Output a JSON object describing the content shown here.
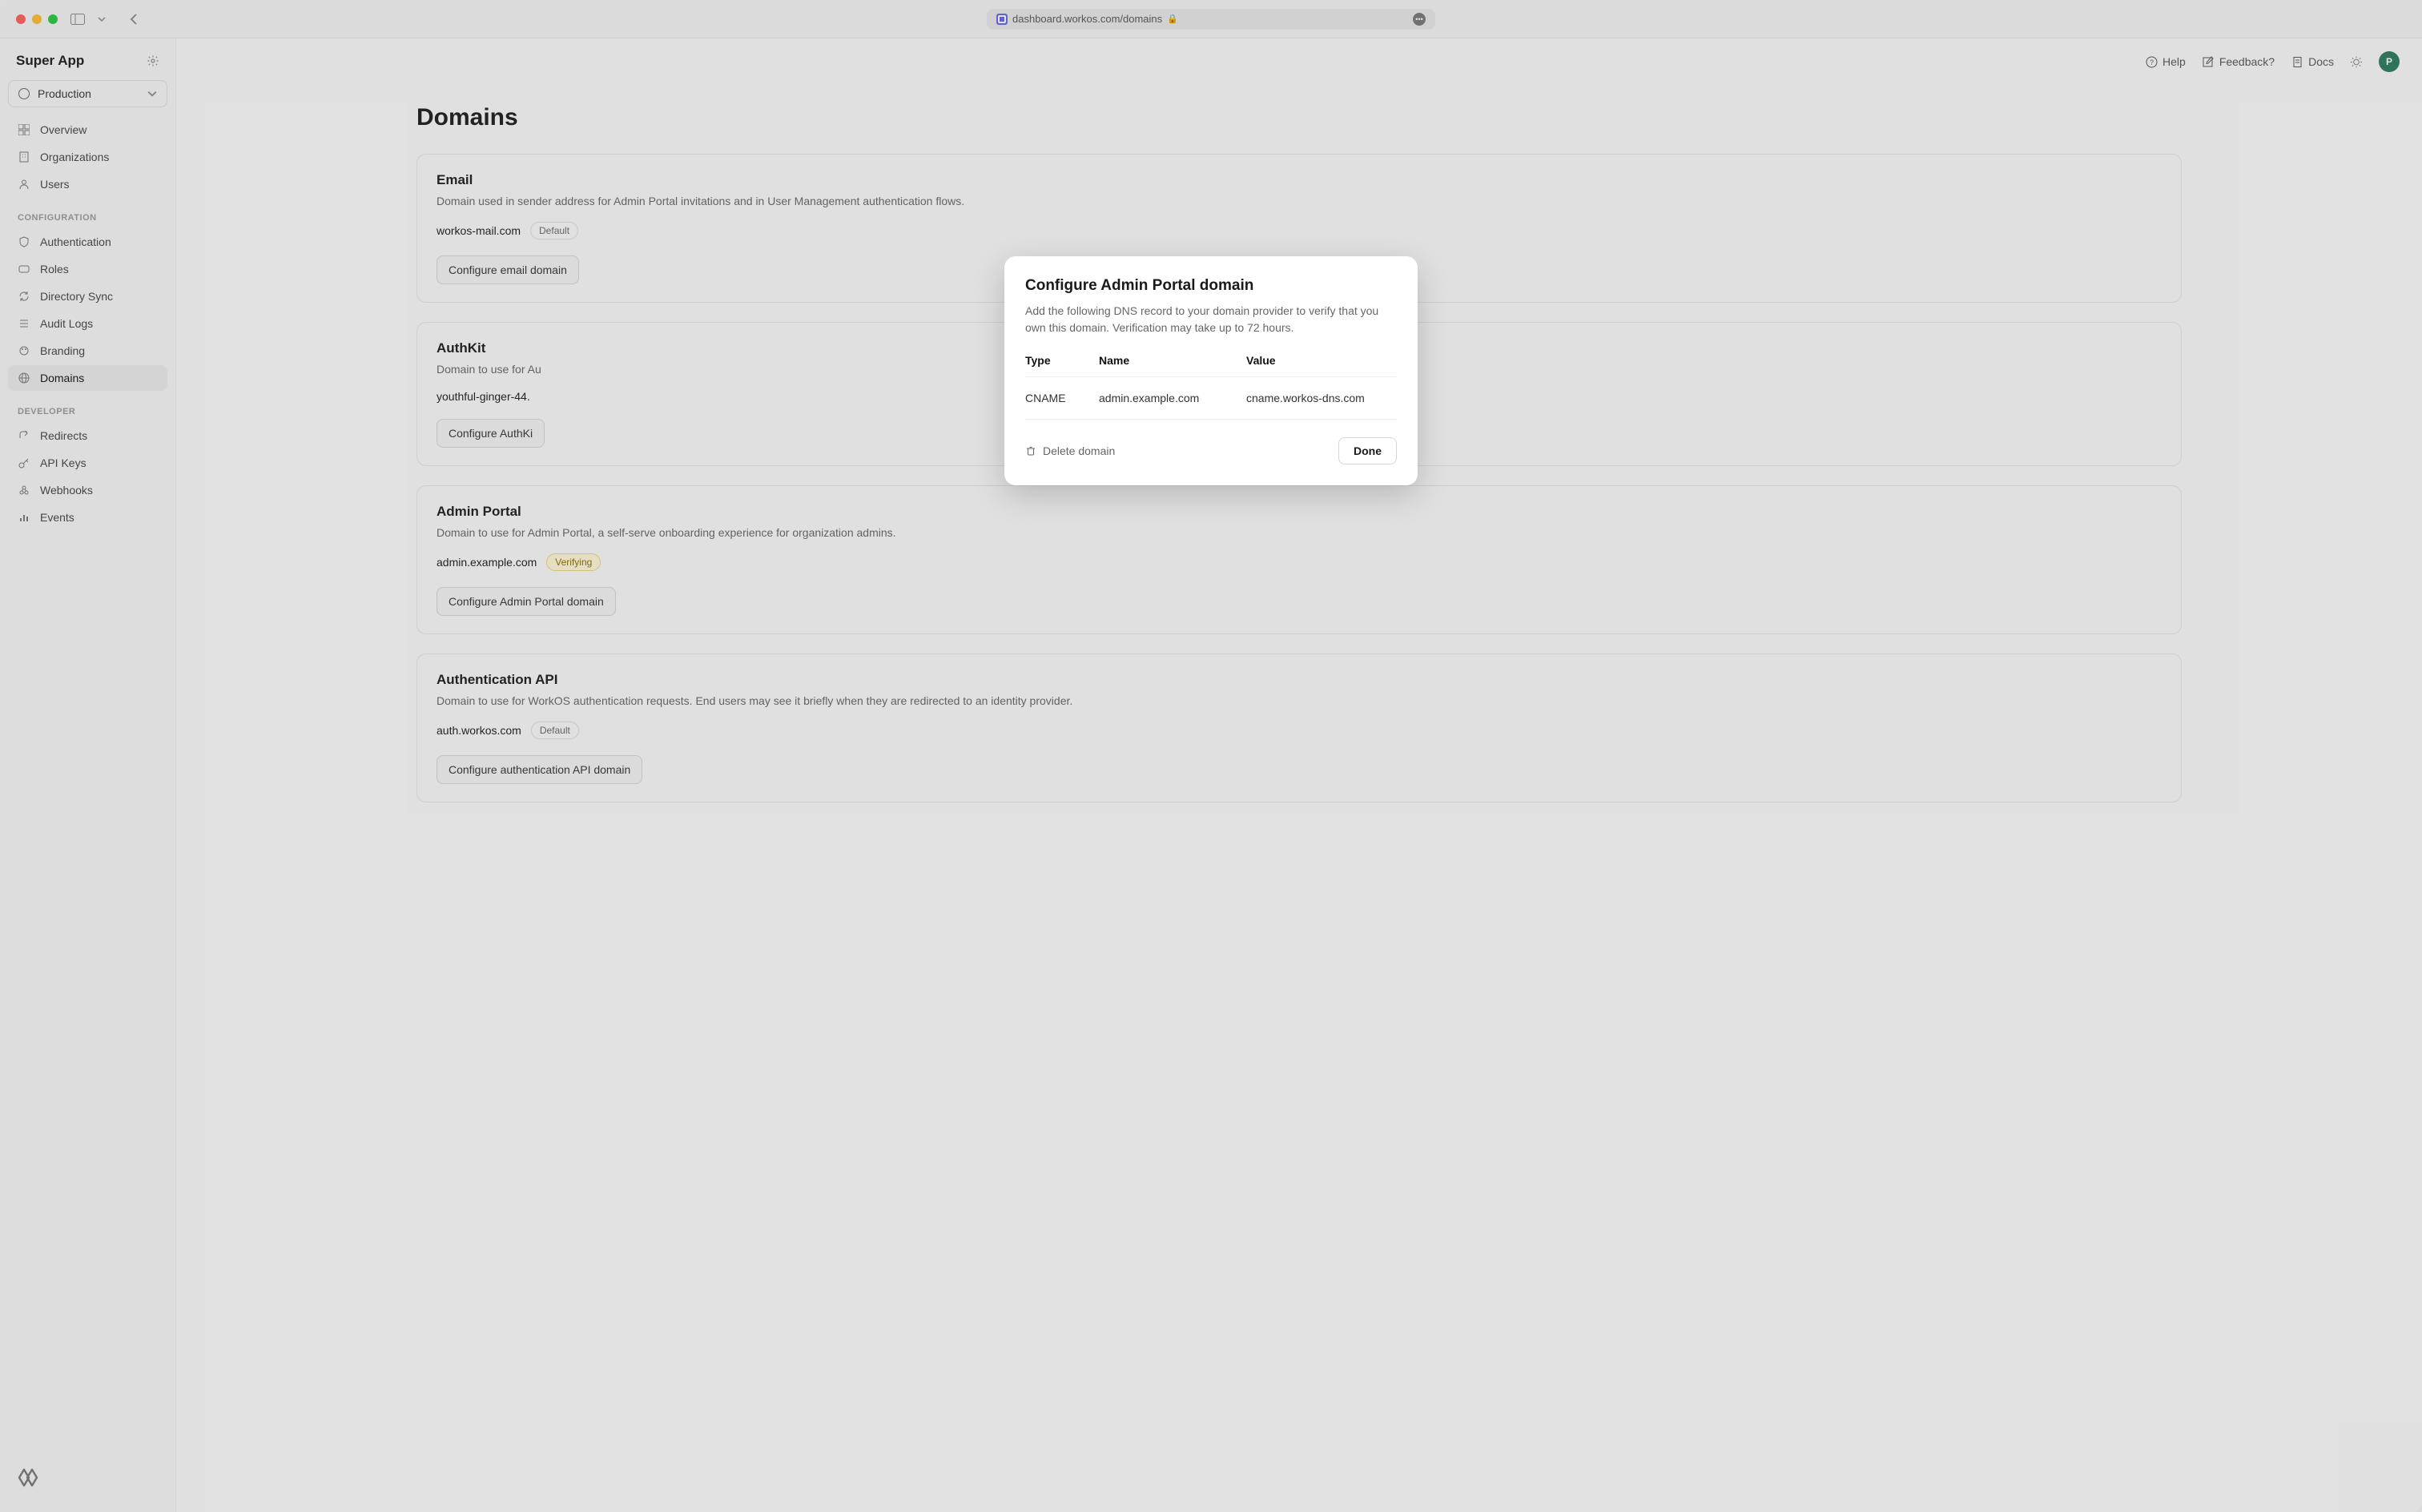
{
  "browser": {
    "url": "dashboard.workos.com/domains"
  },
  "sidebar": {
    "app_name": "Super App",
    "environment": "Production",
    "nav_top": [
      {
        "label": "Overview"
      },
      {
        "label": "Organizations"
      },
      {
        "label": "Users"
      }
    ],
    "section_configuration_label": "CONFIGURATION",
    "nav_configuration": [
      {
        "label": "Authentication"
      },
      {
        "label": "Roles"
      },
      {
        "label": "Directory Sync"
      },
      {
        "label": "Audit Logs"
      },
      {
        "label": "Branding"
      },
      {
        "label": "Domains"
      }
    ],
    "section_developer_label": "DEVELOPER",
    "nav_developer": [
      {
        "label": "Redirects"
      },
      {
        "label": "API Keys"
      },
      {
        "label": "Webhooks"
      },
      {
        "label": "Events"
      }
    ]
  },
  "topbar": {
    "help": "Help",
    "feedback": "Feedback?",
    "docs": "Docs",
    "avatar_initial": "P"
  },
  "page": {
    "title": "Domains",
    "cards": [
      {
        "title": "Email",
        "description": "Domain used in sender address for Admin Portal invitations and in User Management authentication flows.",
        "domain": "workos-mail.com",
        "badge": "Default",
        "button": "Configure email domain"
      },
      {
        "title": "AuthKit",
        "description": "Domain to use for Au",
        "domain": "youthful-ginger-44.",
        "badge": "",
        "button": "Configure AuthKi"
      },
      {
        "title": "Admin Portal",
        "description": "Domain to use for Admin Portal, a self-serve onboarding experience for organization admins.",
        "domain": "admin.example.com",
        "badge": "Verifying",
        "button": "Configure Admin Portal domain"
      },
      {
        "title": "Authentication API",
        "description": "Domain to use for WorkOS authentication requests. End users may see it briefly when they are redirected to an identity provider.",
        "domain": "auth.workos.com",
        "badge": "Default",
        "button": "Configure authentication API domain"
      }
    ]
  },
  "modal": {
    "title": "Configure Admin Portal domain",
    "subtitle": "Add the following DNS record to your domain provider to verify that you own this domain. Verification may take up to 72 hours.",
    "headers": {
      "type": "Type",
      "name": "Name",
      "value": "Value"
    },
    "record": {
      "type": "CNAME",
      "name": "admin.example.com",
      "value": "cname.workos-dns.com"
    },
    "delete_label": "Delete domain",
    "done_label": "Done"
  }
}
